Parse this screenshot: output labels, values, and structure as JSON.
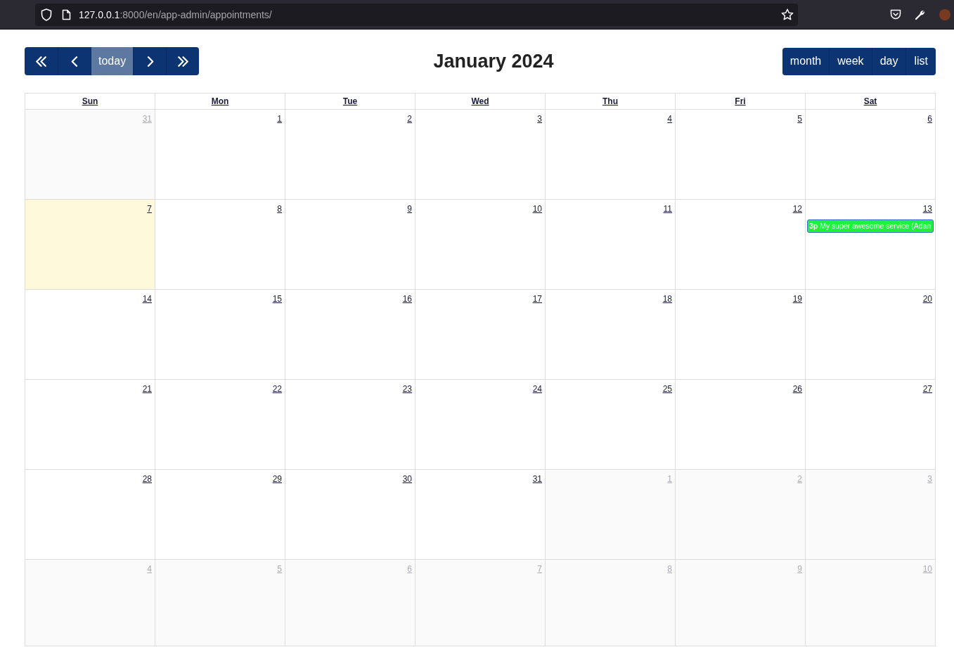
{
  "browser": {
    "url": {
      "host": "127.0.0.1",
      "path": ":8000/en/app-admin/appointments/"
    }
  },
  "toolbar": {
    "nav_buttons": [
      {
        "kind": "double-left"
      },
      {
        "kind": "left"
      },
      {
        "kind": "text",
        "label": "today",
        "disabled": true
      },
      {
        "kind": "right"
      },
      {
        "kind": "double-right"
      }
    ],
    "title": "January 2024",
    "view_buttons": [
      {
        "label": "month"
      },
      {
        "label": "week"
      },
      {
        "label": "day"
      },
      {
        "label": "list"
      }
    ]
  },
  "calendar": {
    "columns": [
      {
        "label": "Sun"
      },
      {
        "label": "Mon"
      },
      {
        "label": "Tue"
      },
      {
        "label": "Wed"
      },
      {
        "label": "Thu"
      },
      {
        "label": "Fri"
      },
      {
        "label": "Sat"
      }
    ],
    "weeks": [
      {
        "days": [
          {
            "number": "31",
            "other_month": true,
            "today": false
          },
          {
            "number": "1",
            "other_month": false,
            "today": false
          },
          {
            "number": "2",
            "other_month": false,
            "today": false
          },
          {
            "number": "3",
            "other_month": false,
            "today": false
          },
          {
            "number": "4",
            "other_month": false,
            "today": false
          },
          {
            "number": "5",
            "other_month": false,
            "today": false
          },
          {
            "number": "6",
            "other_month": false,
            "today": false
          }
        ]
      },
      {
        "days": [
          {
            "number": "7",
            "other_month": false,
            "today": true
          },
          {
            "number": "8",
            "other_month": false,
            "today": false
          },
          {
            "number": "9",
            "other_month": false,
            "today": false
          },
          {
            "number": "10",
            "other_month": false,
            "today": false
          },
          {
            "number": "11",
            "other_month": false,
            "today": false
          },
          {
            "number": "12",
            "other_month": false,
            "today": false
          },
          {
            "number": "13",
            "other_month": false,
            "today": false,
            "events": [
              {
                "time": "3p",
                "title": "My super awesome service (Adan",
                "color": "#1ef23c"
              }
            ]
          }
        ]
      },
      {
        "days": [
          {
            "number": "14",
            "other_month": false,
            "today": false
          },
          {
            "number": "15",
            "other_month": false,
            "today": false
          },
          {
            "number": "16",
            "other_month": false,
            "today": false
          },
          {
            "number": "17",
            "other_month": false,
            "today": false
          },
          {
            "number": "18",
            "other_month": false,
            "today": false
          },
          {
            "number": "19",
            "other_month": false,
            "today": false
          },
          {
            "number": "20",
            "other_month": false,
            "today": false
          }
        ]
      },
      {
        "days": [
          {
            "number": "21",
            "other_month": false,
            "today": false
          },
          {
            "number": "22",
            "other_month": false,
            "today": false
          },
          {
            "number": "23",
            "other_month": false,
            "today": false
          },
          {
            "number": "24",
            "other_month": false,
            "today": false
          },
          {
            "number": "25",
            "other_month": false,
            "today": false
          },
          {
            "number": "26",
            "other_month": false,
            "today": false
          },
          {
            "number": "27",
            "other_month": false,
            "today": false
          }
        ]
      },
      {
        "days": [
          {
            "number": "28",
            "other_month": false,
            "today": false
          },
          {
            "number": "29",
            "other_month": false,
            "today": false
          },
          {
            "number": "30",
            "other_month": false,
            "today": false
          },
          {
            "number": "31",
            "other_month": false,
            "today": false
          },
          {
            "number": "1",
            "other_month": true,
            "today": false
          },
          {
            "number": "2",
            "other_month": true,
            "today": false
          },
          {
            "number": "3",
            "other_month": true,
            "today": false
          }
        ]
      },
      {
        "days": [
          {
            "number": "4",
            "other_month": true,
            "today": false
          },
          {
            "number": "5",
            "other_month": true,
            "today": false
          },
          {
            "number": "6",
            "other_month": true,
            "today": false
          },
          {
            "number": "7",
            "other_month": true,
            "today": false
          },
          {
            "number": "8",
            "other_month": true,
            "today": false
          },
          {
            "number": "9",
            "other_month": true,
            "today": false
          },
          {
            "number": "10",
            "other_month": true,
            "today": false
          }
        ]
      }
    ]
  }
}
